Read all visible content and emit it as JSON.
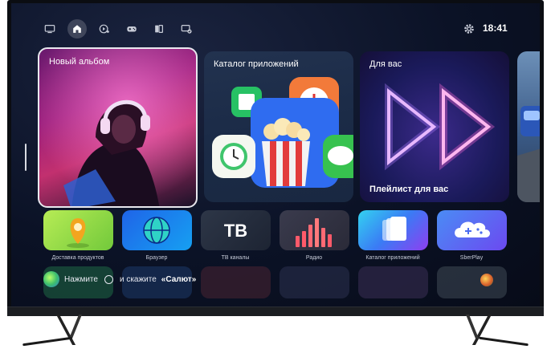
{
  "clock": "18:41",
  "nav": {
    "items": [
      {
        "icon": "tv-icon"
      },
      {
        "icon": "home-icon",
        "active": true
      },
      {
        "icon": "media-icon"
      },
      {
        "icon": "gamepad-icon"
      },
      {
        "icon": "library-icon"
      },
      {
        "icon": "screen-share-icon"
      }
    ]
  },
  "hero": {
    "new_album": {
      "title": "Новый альбом"
    },
    "app_catalog": {
      "title": "Каталог приложений"
    },
    "for_you": {
      "title": "Для вас",
      "subtitle": "Плейлист для вас"
    }
  },
  "tiles": [
    {
      "label": "Доставка продуктов"
    },
    {
      "label": "Браузер"
    },
    {
      "label": "ТВ каналы",
      "text": "ТВ"
    },
    {
      "label": "Радио"
    },
    {
      "label": "Каталог приложений"
    },
    {
      "label": "SberPlay"
    }
  ],
  "voice": {
    "prefix": "Нажмите",
    "middle": "и скажите",
    "command": "«Салют»"
  },
  "colors": {
    "accent": "#ffffff",
    "screen_bg": "#0b1226"
  }
}
